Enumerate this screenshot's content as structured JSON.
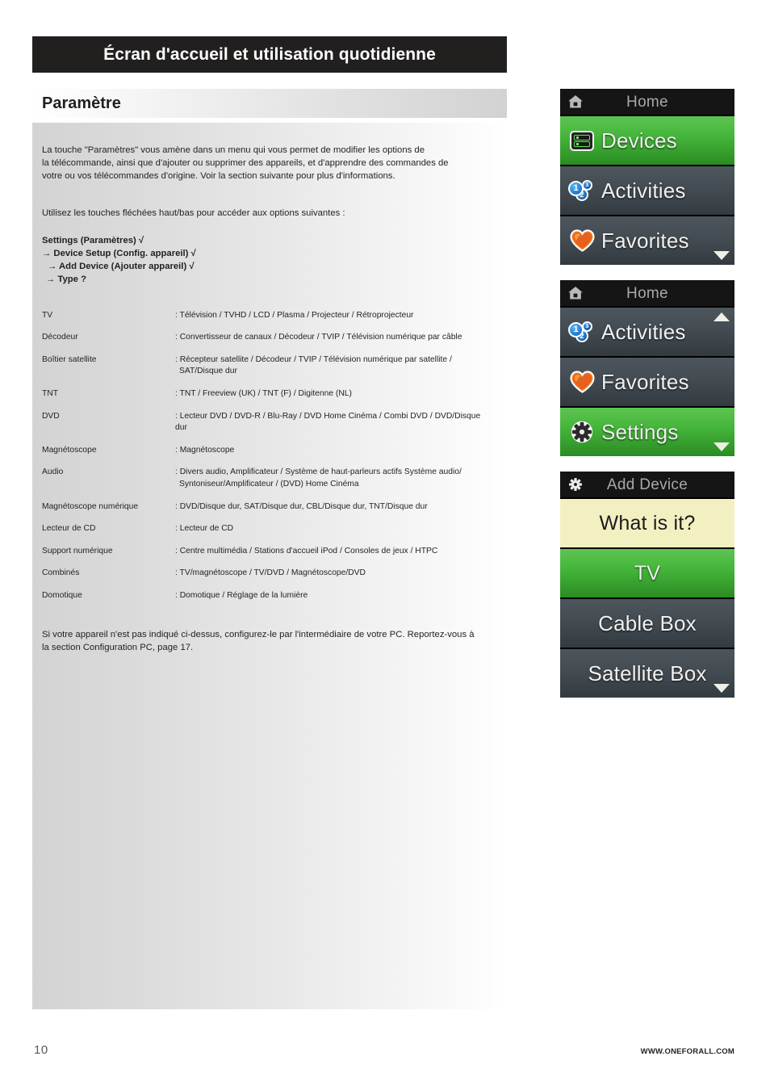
{
  "header": {
    "title": "Écran d'accueil et utilisation quotidienne"
  },
  "section": {
    "heading": "Paramètre"
  },
  "body": {
    "intro_line1": "La touche \"Paramètres\" vous amène dans un menu qui vous permet de modifier les options de",
    "intro_line2": "la télécommande, ainsi que d'ajouter ou supprimer des appareils, et d'apprendre des commandes de",
    "intro_line3": "votre ou vos télécommandes d'origine. Voir la section suivante pour plus d'informations.",
    "instruction": "Utilisez les touches fléchées haut/bas pour accéder aux options suivantes :",
    "steps": [
      "Settings (Paramètres) √",
      "→ Device Setup (Config. appareil) √",
      "→ Add Device (Ajouter appareil) √",
      "→ Type ?"
    ],
    "closing_line1": "Si votre appareil n'est pas indiqué ci-dessus, configurez-le par l'intermédiaire de votre PC. Reportez-vous à",
    "closing_line2": "la section Configuration PC, page 17."
  },
  "device_table": {
    "rows": [
      {
        "name": "TV",
        "desc": ": Télévision / TVHD / LCD / Plasma / Projecteur / Rétroprojecteur",
        "desc2": ""
      },
      {
        "name": "Décodeur",
        "desc": ": Convertisseur de canaux / Décodeur / TVIP / Télévision numérique par câble",
        "desc2": ""
      },
      {
        "name": "Boîtier satellite",
        "desc": ": Récepteur satellite / Décodeur / TVIP / Télévision numérique par satellite /",
        "desc2": "SAT/Disque dur"
      },
      {
        "name": "TNT",
        "desc": ": TNT / Freeview (UK) / TNT (F) / Digitenne (NL)",
        "desc2": ""
      },
      {
        "name": "DVD",
        "desc": ": Lecteur DVD / DVD-R / Blu-Ray / DVD Home Cinéma /  Combi DVD / DVD/Disque dur",
        "desc2": ""
      },
      {
        "name": "Magnétoscope",
        "desc": ": Magnétoscope",
        "desc2": ""
      },
      {
        "name": "Audio",
        "desc": ": Divers audio, Amplificateur / Système de haut-parleurs actifs Système audio/",
        "desc2": "Syntoniseur/Amplificateur / (DVD) Home Cinéma"
      },
      {
        "name": "Magnétoscope numérique",
        "desc": ": DVD/Disque dur, SAT/Disque dur, CBL/Disque dur, TNT/Disque dur",
        "desc2": ""
      },
      {
        "name": "Lecteur de CD",
        "desc": ": Lecteur de CD",
        "desc2": ""
      },
      {
        "name": "Support numérique",
        "desc": ": Centre multimédia / Stations d'accueil iPod / Consoles de jeux / HTPC",
        "desc2": ""
      },
      {
        "name": "Combinés",
        "desc": ": TV/magnétoscope / TV/DVD / Magnétoscope/DVD",
        "desc2": ""
      },
      {
        "name": "Domotique",
        "desc": ": Domotique / Réglage de la lumière",
        "desc2": ""
      }
    ]
  },
  "screens": [
    {
      "id": "home-devices",
      "header_title": "Home",
      "header_icon": "home-icon",
      "scroll": "down",
      "items": [
        {
          "label": "Devices",
          "icon": "devices-icon",
          "state": "selected"
        },
        {
          "label": "Activities",
          "icon": "activities-icon",
          "state": "normal"
        },
        {
          "label": "Favorites",
          "icon": "heart-icon",
          "state": "normal"
        }
      ]
    },
    {
      "id": "home-settings",
      "header_title": "Home",
      "header_icon": "home-icon",
      "scroll": "both",
      "items": [
        {
          "label": "Activities",
          "icon": "activities-icon",
          "state": "normal"
        },
        {
          "label": "Favorites",
          "icon": "heart-icon",
          "state": "normal"
        },
        {
          "label": "Settings",
          "icon": "gear-icon",
          "state": "selected"
        }
      ]
    },
    {
      "id": "add-device",
      "header_title": "Add Device",
      "header_icon": "gear-icon",
      "scroll": "down",
      "items": [
        {
          "label": "What is it?",
          "icon": "",
          "state": "prompt"
        },
        {
          "label": "TV",
          "icon": "",
          "state": "selected"
        },
        {
          "label": "Cable Box",
          "icon": "",
          "state": "normal"
        },
        {
          "label": "Satellite Box",
          "icon": "",
          "state": "normal"
        }
      ]
    }
  ],
  "activity_badges": [
    "1",
    "2",
    "3"
  ],
  "footer": {
    "page_number": "10",
    "url": "WWW.ONEFORALL.COM"
  },
  "colors": {
    "title_bar": "#221f20",
    "selected_green": "#45b63b",
    "row_dark": "#434c52",
    "prompt_yellow": "#f2f0c1",
    "screen_header": "#151515"
  }
}
